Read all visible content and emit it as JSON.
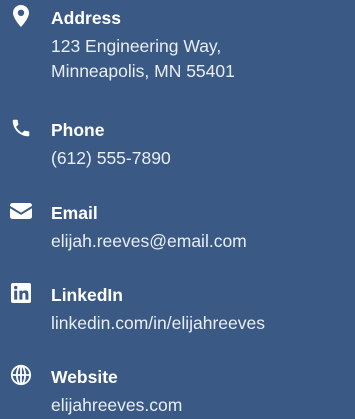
{
  "colors": {
    "background": "#3a5a85",
    "label_text": "#ffffff",
    "value_text": "#e9eef5"
  },
  "contacts": [
    {
      "icon": "map-marker-icon",
      "label": "Address",
      "value_lines": [
        "123 Engineering Way,",
        "Minneapolis, MN 55401"
      ]
    },
    {
      "icon": "phone-icon",
      "label": "Phone",
      "value_lines": [
        "(612) 555-7890"
      ]
    },
    {
      "icon": "envelope-icon",
      "label": "Email",
      "value_lines": [
        "elijah.reeves@email.com"
      ]
    },
    {
      "icon": "linkedin-icon",
      "label": "LinkedIn",
      "value_lines": [
        "linkedin.com/in/elijahreeves"
      ]
    },
    {
      "icon": "globe-icon",
      "label": "Website",
      "value_lines": [
        "elijahreeves.com"
      ]
    }
  ]
}
